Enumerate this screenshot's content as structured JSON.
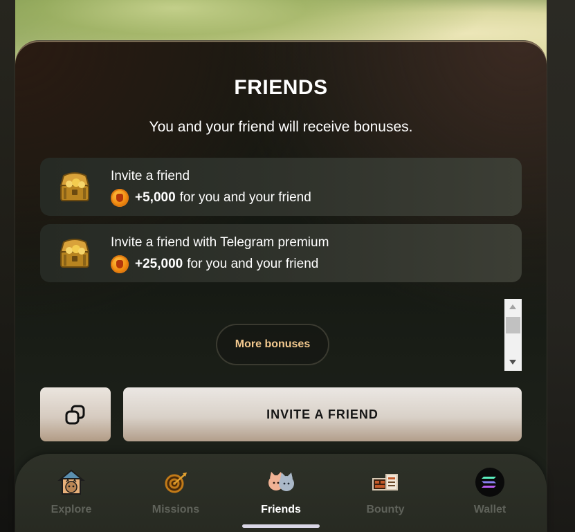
{
  "header": {
    "title": "FRIENDS",
    "subtitle": "You and your friend will receive bonuses."
  },
  "bonuses": [
    {
      "title": "Invite a friend",
      "amount": "+5,000",
      "suffix": "for you and your friend",
      "icon": "treasure-chest-icon"
    },
    {
      "title": "Invite a friend with Telegram premium",
      "amount": "+25,000",
      "suffix": "for you and your friend",
      "icon": "treasure-chest-icon"
    }
  ],
  "more_bonuses_label": "More bonuses",
  "actions": {
    "copy_icon": "copy-icon",
    "invite_label": "INVITE A FRIEND"
  },
  "nav": {
    "active": "Friends",
    "items": [
      {
        "label": "Explore",
        "icon": "cat-house-icon"
      },
      {
        "label": "Missions",
        "icon": "target-icon"
      },
      {
        "label": "Friends",
        "icon": "cat-friends-icon"
      },
      {
        "label": "Bounty",
        "icon": "bounty-icon"
      },
      {
        "label": "Wallet",
        "icon": "solana-icon"
      }
    ]
  },
  "colors": {
    "accent_text": "#f2c88e",
    "button_light": "#e6e0d9",
    "card_bg": "#2f322b",
    "nav_inactive": "#5f625a",
    "coin": "#f08a10"
  }
}
